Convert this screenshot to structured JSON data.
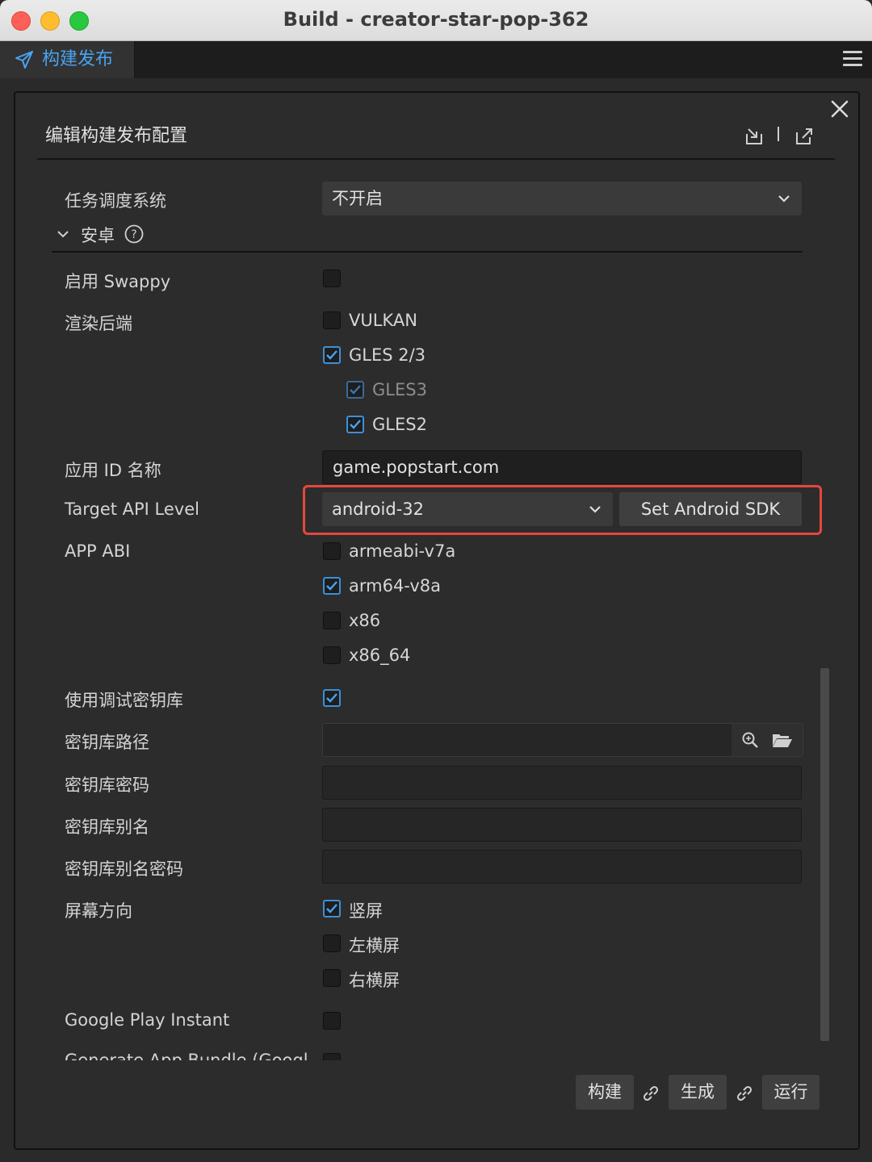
{
  "window": {
    "title": "Build - creator-star-pop-362"
  },
  "tabs": [
    {
      "label": "构建发布"
    }
  ],
  "panel": {
    "title": "编辑构建发布配置"
  },
  "task_scheduler": {
    "label": "任务调度系统",
    "value": "不开启"
  },
  "section": {
    "title": "安卓"
  },
  "swappy": {
    "label": "启用 Swappy",
    "checked": false
  },
  "render_backend": {
    "label": "渲染后端",
    "options": [
      {
        "label": "VULKAN",
        "checked": false
      },
      {
        "label": "GLES 2/3",
        "checked": true
      },
      {
        "label": "GLES3",
        "checked": true
      },
      {
        "label": "GLES2",
        "checked": true
      }
    ]
  },
  "app_id": {
    "label": "应用 ID 名称",
    "value": "game.popstart.com"
  },
  "target_api": {
    "label": "Target API Level",
    "value": "android-32",
    "button": "Set Android SDK"
  },
  "app_abi": {
    "label": "APP ABI",
    "options": [
      {
        "label": "armeabi-v7a",
        "checked": false
      },
      {
        "label": "arm64-v8a",
        "checked": true
      },
      {
        "label": "x86",
        "checked": false
      },
      {
        "label": "x86_64",
        "checked": false
      }
    ]
  },
  "debug_keystore": {
    "label": "使用调试密钥库",
    "checked": true
  },
  "keystore_path": {
    "label": "密钥库路径",
    "value": ""
  },
  "keystore_password": {
    "label": "密钥库密码",
    "value": ""
  },
  "keystore_alias": {
    "label": "密钥库别名",
    "value": ""
  },
  "keystore_alias_password": {
    "label": "密钥库别名密码",
    "value": ""
  },
  "orientation": {
    "label": "屏幕方向",
    "options": [
      {
        "label": "竖屏",
        "checked": true
      },
      {
        "label": "左横屏",
        "checked": false
      },
      {
        "label": "右横屏",
        "checked": false
      }
    ]
  },
  "google_play_instant": {
    "label": "Google Play Instant",
    "checked": false
  },
  "app_bundle": {
    "label": "Generate App Bundle (Googl"
  },
  "footer": {
    "build": "构建",
    "make": "生成",
    "run": "运行"
  },
  "colors": {
    "accent": "#3e8fd6",
    "highlight": "#e4483c",
    "tab_text": "#4aa3f0"
  }
}
